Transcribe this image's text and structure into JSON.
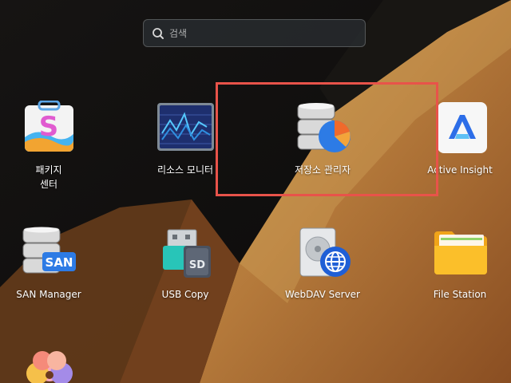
{
  "search": {
    "placeholder": "검색"
  },
  "apps": {
    "package_center": {
      "label_line1": "패키지",
      "label_line2": "센터"
    },
    "resource_monitor": {
      "label": "리소스 모니터"
    },
    "storage_manager": {
      "label": "저장소 관리자"
    },
    "active_insight": {
      "label": "Active Insight"
    },
    "san_manager": {
      "label": "SAN Manager",
      "badge": "SAN"
    },
    "usb_copy": {
      "label": "USB Copy",
      "badge": "SD"
    },
    "webdav_server": {
      "label": "WebDAV Server"
    },
    "file_station": {
      "label": "File Station"
    }
  },
  "colors": {
    "highlight": "#e8534a",
    "accent_blue": "#2d7be5"
  }
}
